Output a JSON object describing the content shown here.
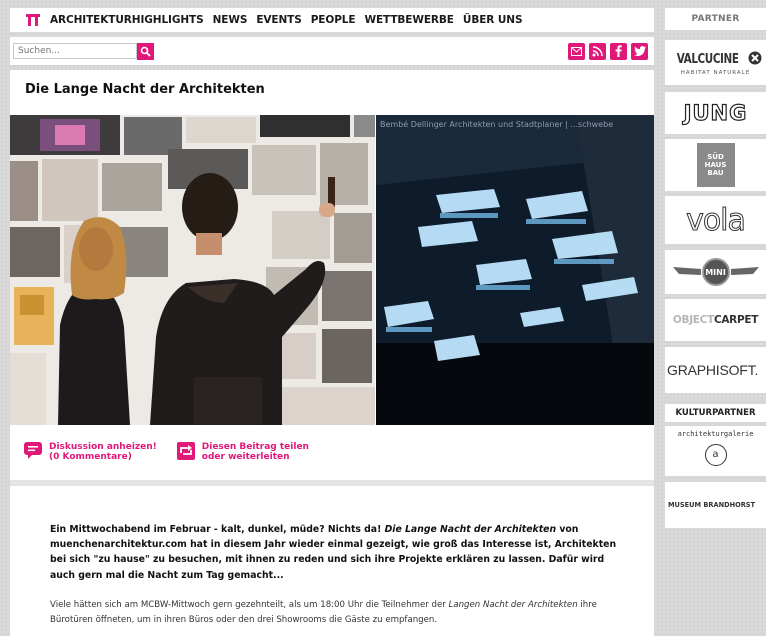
{
  "nav": {
    "items": [
      "ARCHITEKTURHIGHLIGHTS",
      "NEWS",
      "EVENTS",
      "PEOPLE",
      "WETTBEWERBE",
      "ÜBER UNS"
    ],
    "accent_color": "#e0187a"
  },
  "search": {
    "placeholder": "Suchen..."
  },
  "social": {
    "icons": [
      "mail-icon",
      "rss-icon",
      "facebook-icon",
      "twitter-icon"
    ]
  },
  "article": {
    "title": "Die Lange Nacht der Architekten",
    "photo_caption": "Bembé Dellinger Architekten und Stadtplaner | ...schwebe",
    "actions": {
      "discuss_line1": "Diskussion anheizen!",
      "discuss_line2": "(0 Kommentare)",
      "share_line1": "Diesen Beitrag teilen",
      "share_line2": "oder weiterleiten"
    },
    "lead": {
      "part1": "Ein Mittwochabend im Februar - kalt, dunkel, müde? Nichts da! ",
      "part2": "Die Lange Nacht der Architekten",
      "part3": " von muenchenarchitektur.com hat in diesem Jahr wieder einmal gezeigt, wie groß das Interesse ist, Architekten bei sich \"zu hause\" zu besuchen, mit ihnen zu reden und sich ihre Projekte erklären zu lassen. Dafür wird auch gern mal die Nacht zum Tag gemacht..."
    },
    "body": {
      "part1": "Viele hätten sich am MCBW-Mittwoch gern gezehnteilt, als um 18:00 Uhr die Teilnehmer der ",
      "part2": "Langen Nacht der Architekten",
      "part3": " ihre Bürotüren öffneten, um in ihren Büros oder den drei Showrooms die Gäste zu empfangen."
    }
  },
  "sidebar": {
    "partner_title": "PARTNER",
    "partners": {
      "valcucine": "VALCUCINE",
      "valcucine_sub": "HABITAT NATURALE",
      "jung": "JUNG",
      "sued1": "SÜD",
      "sued2": "HAUS",
      "sued3": "BAU",
      "vola": "vola",
      "mini": "MINI",
      "object": "OBJECT",
      "carpet": "CARPET",
      "graphisoft": "GRAPHISOFT."
    },
    "kultur_title": "KULTURPARTNER",
    "kultur": {
      "galerie": "architekturgalerie",
      "galerie_mark": "a",
      "museum": "MUSEUM BRANDHORST"
    }
  }
}
